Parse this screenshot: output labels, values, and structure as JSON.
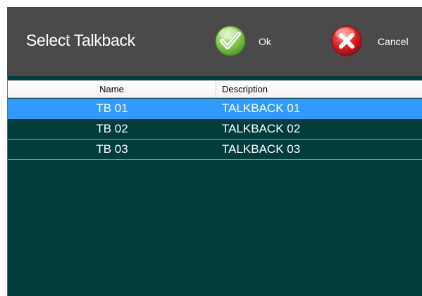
{
  "dialog": {
    "title": "Select Talkback",
    "ok_label": "Ok",
    "cancel_label": "Cancel",
    "ok_icon": "checkmark-icon",
    "cancel_icon": "close-icon",
    "colors": {
      "header_bg": "#4a4a4a",
      "grid_bg": "#023c3c",
      "selected_row": "#3399ff",
      "ok_green": "#7cc04b",
      "cancel_red": "#e0242a"
    }
  },
  "grid": {
    "columns": [
      "Name",
      "Description"
    ],
    "rows": [
      {
        "name": "TB 01",
        "description": "TALKBACK 01",
        "selected": true
      },
      {
        "name": "TB 02",
        "description": "TALKBACK 02",
        "selected": false
      },
      {
        "name": "TB 03",
        "description": "TALKBACK 03",
        "selected": false
      }
    ]
  }
}
